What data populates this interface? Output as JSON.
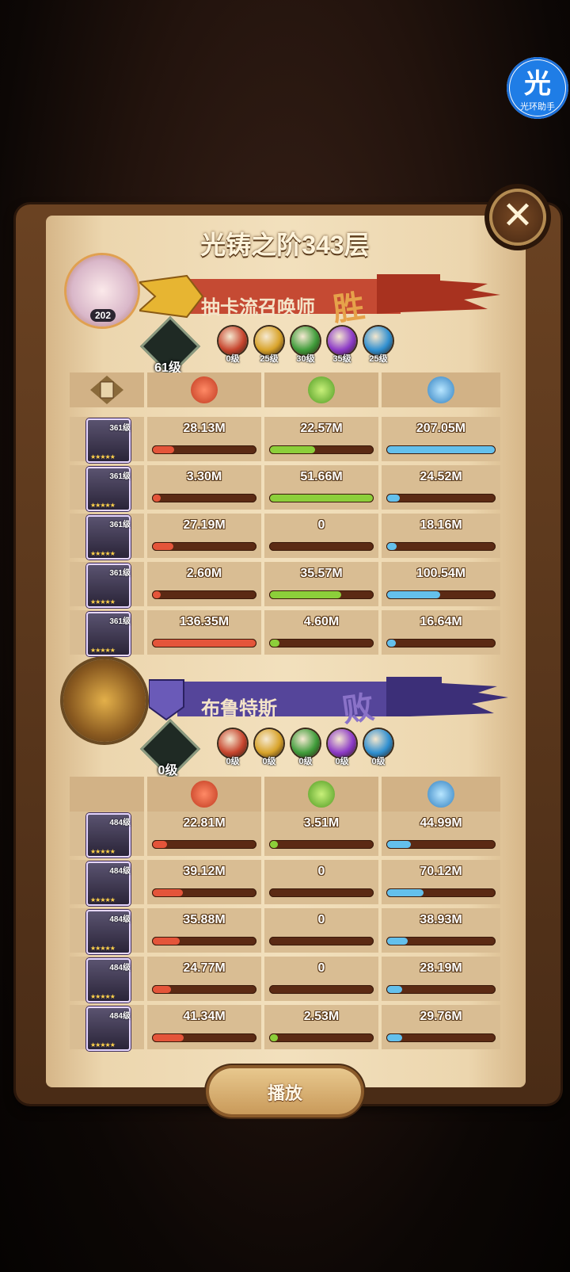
{
  "assistant": {
    "glyph": "光",
    "label": "光环助手"
  },
  "title": "光铸之阶343层",
  "close_icon": "close-icon",
  "colors": {
    "damage": "#e4553a",
    "heal": "#8ccf3a",
    "shield": "#64c0ec",
    "win_banner": "#b8392a",
    "lose_banner": "#4e3d8f"
  },
  "teams": [
    {
      "player_name": "抽卡流召唤师",
      "result": "胜",
      "avatar_level": "202",
      "tree_level": "61级",
      "gems": [
        {
          "icon": "fire-gem-icon",
          "level": "0级",
          "color": "#c7452e"
        },
        {
          "icon": "gold-gem-icon",
          "level": "25级",
          "color": "#d8a32a"
        },
        {
          "icon": "green-gem-icon",
          "level": "30级",
          "color": "#3f9c3a"
        },
        {
          "icon": "purple-gem-icon",
          "level": "35级",
          "color": "#8c3ac7"
        },
        {
          "icon": "blue-gem-icon",
          "level": "25级",
          "color": "#2f8fd0"
        }
      ],
      "heroes": [
        {
          "level": "361级",
          "damage": "28.13M",
          "heal": "22.57M",
          "shield": "207.05M",
          "damage_ratio": 0.21,
          "heal_ratio": 0.44,
          "shield_ratio": 1.0
        },
        {
          "level": "361级",
          "damage": "3.30M",
          "heal": "51.66M",
          "shield": "24.52M",
          "damage_ratio": 0.03,
          "heal_ratio": 1.0,
          "shield_ratio": 0.12
        },
        {
          "level": "361级",
          "damage": "27.19M",
          "heal": "0",
          "shield": "18.16M",
          "damage_ratio": 0.2,
          "heal_ratio": 0,
          "shield_ratio": 0.09
        },
        {
          "level": "361级",
          "damage": "2.60M",
          "heal": "35.57M",
          "shield": "100.54M",
          "damage_ratio": 0.02,
          "heal_ratio": 0.69,
          "shield_ratio": 0.49
        },
        {
          "level": "361级",
          "damage": "136.35M",
          "heal": "4.60M",
          "shield": "16.64M",
          "damage_ratio": 1.0,
          "heal_ratio": 0.09,
          "shield_ratio": 0.08
        }
      ]
    },
    {
      "player_name": "布鲁特斯",
      "result": "败",
      "tree_level": "0级",
      "gems": [
        {
          "icon": "fire-gem-icon",
          "level": "0级",
          "color": "#c7452e"
        },
        {
          "icon": "gold-gem-icon",
          "level": "0级",
          "color": "#d8a32a"
        },
        {
          "icon": "green-gem-icon",
          "level": "0级",
          "color": "#3f9c3a"
        },
        {
          "icon": "purple-gem-icon",
          "level": "0级",
          "color": "#8c3ac7"
        },
        {
          "icon": "blue-gem-icon",
          "level": "0级",
          "color": "#2f8fd0"
        }
      ],
      "heroes": [
        {
          "level": "484级",
          "damage": "22.81M",
          "heal": "3.51M",
          "shield": "44.99M",
          "damage_ratio": 0.14,
          "heal_ratio": 0.07,
          "shield_ratio": 0.22
        },
        {
          "level": "484级",
          "damage": "39.12M",
          "heal": "0",
          "shield": "70.12M",
          "damage_ratio": 0.29,
          "heal_ratio": 0,
          "shield_ratio": 0.34
        },
        {
          "level": "484级",
          "damage": "35.88M",
          "heal": "0",
          "shield": "38.93M",
          "damage_ratio": 0.26,
          "heal_ratio": 0,
          "shield_ratio": 0.19
        },
        {
          "level": "484级",
          "damage": "24.77M",
          "heal": "0",
          "shield": "28.19M",
          "damage_ratio": 0.18,
          "heal_ratio": 0,
          "shield_ratio": 0.14
        },
        {
          "level": "484级",
          "damage": "41.34M",
          "heal": "2.53M",
          "shield": "29.76M",
          "damage_ratio": 0.3,
          "heal_ratio": 0.05,
          "shield_ratio": 0.14
        }
      ]
    }
  ],
  "column_icons": [
    "damage-icon",
    "heal-icon",
    "shield-icon"
  ],
  "play_label": "播放"
}
